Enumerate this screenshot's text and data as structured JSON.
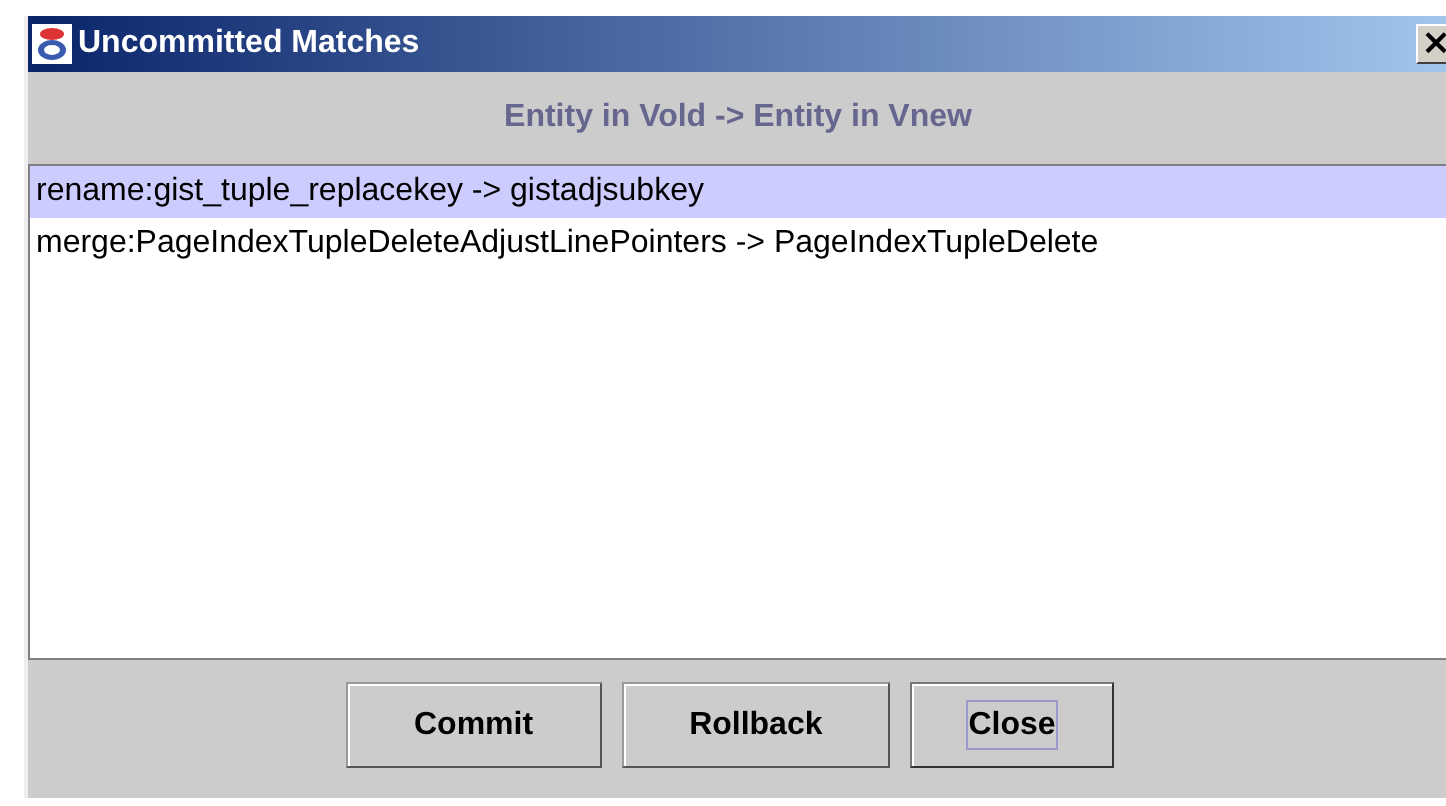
{
  "window": {
    "title": "Uncommitted Matches",
    "close_glyph": "×"
  },
  "header": "Entity in Vold -> Entity in Vnew",
  "matches": [
    {
      "text": "rename:gist_tuple_replacekey -> gistadjsubkey",
      "selected": true
    },
    {
      "text": "merge:PageIndexTupleDeleteAdjustLinePointers -> PageIndexTupleDelete",
      "selected": false
    }
  ],
  "buttons": [
    {
      "label": "Commit",
      "focused": false
    },
    {
      "label": "Rollback",
      "focused": false
    },
    {
      "label": "Close",
      "focused": true
    }
  ]
}
